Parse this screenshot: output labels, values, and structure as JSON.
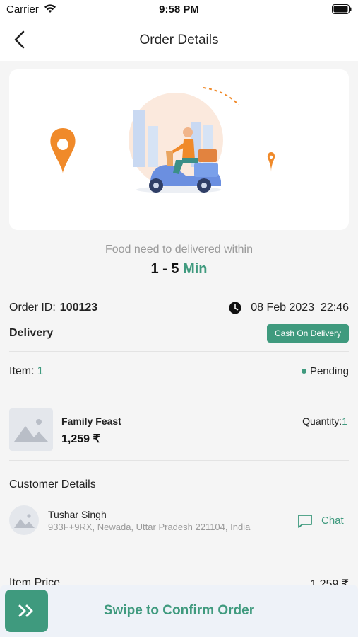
{
  "status_bar": {
    "carrier": "Carrier",
    "time": "9:58 PM"
  },
  "nav": {
    "title": "Order Details",
    "back_icon": "chevron-left-icon"
  },
  "hero": {
    "illustration": "delivery-scooter-illustration",
    "icons": [
      "location-pin-icon",
      "location-pin-icon"
    ]
  },
  "delivery_window": {
    "text": "Food need to delivered within",
    "range": "1 - 5",
    "unit": "Min"
  },
  "order": {
    "id_label": "Order ID:",
    "id_value": "100123",
    "date": "08 Feb 2023",
    "time": "22:46",
    "type": "Delivery",
    "payment": "Cash On Delivery",
    "items_label": "Item:",
    "items_count": "1",
    "status": "Pending"
  },
  "product": {
    "name": "Family Feast",
    "price": "1,259 ₹",
    "quantity_label": "Quantity:",
    "quantity_value": "1",
    "thumb_icon": "image-placeholder-icon"
  },
  "customer": {
    "section_title": "Customer Details",
    "name": "Tushar Singh",
    "address": "933F+9RX, Newada, Uttar Pradesh 221104, India",
    "chat_label": "Chat",
    "chat_icon": "chat-bubble-icon"
  },
  "pricing": {
    "item_price_label": "Item Price",
    "item_price_value": "1,259 ₹"
  },
  "swipe": {
    "label": "Swipe to Confirm Order",
    "icon": "double-chevron-right-icon"
  },
  "colors": {
    "accent": "#3f9a7e",
    "background": "#f5f5f5",
    "muted_text": "#9a9a9a",
    "pin_orange": "#f08a2a"
  }
}
